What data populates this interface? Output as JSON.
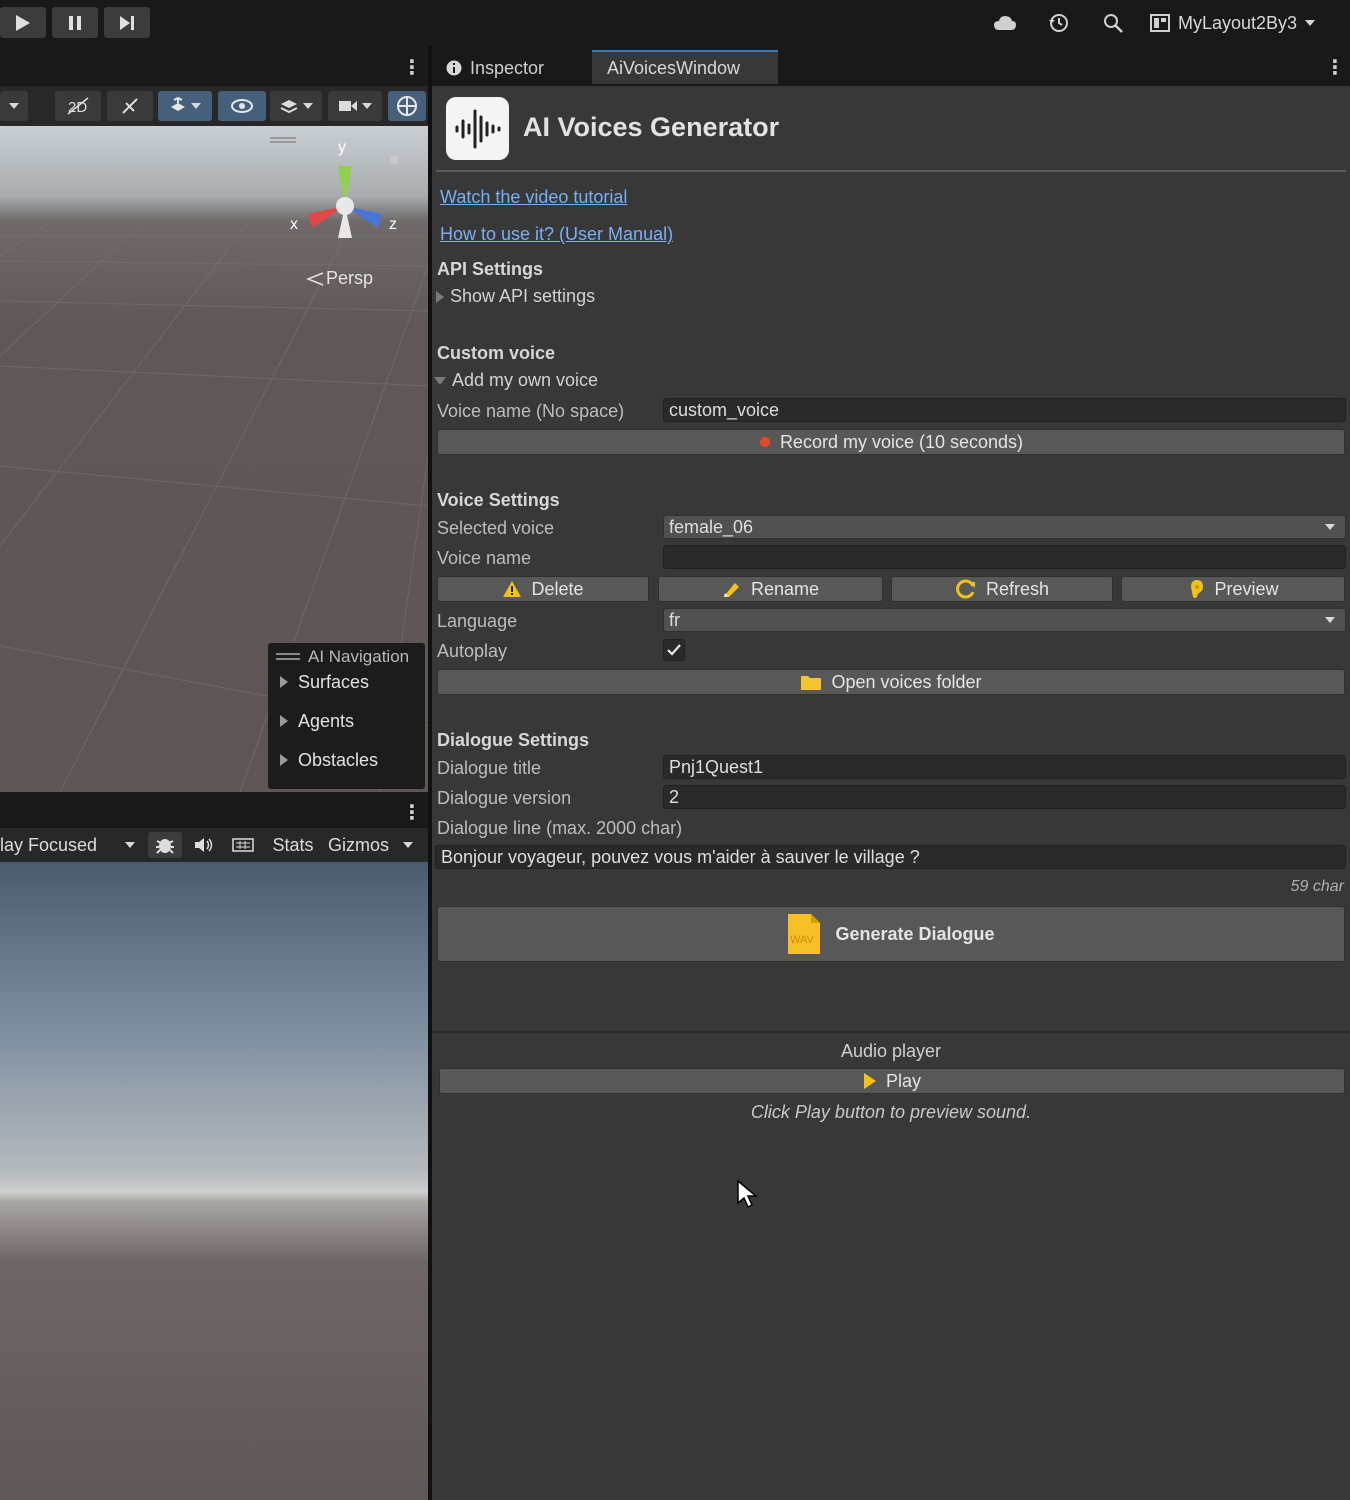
{
  "toolbar": {
    "layout_label": "MyLayout2By3"
  },
  "scene": {
    "persp_label": "Persp",
    "axis_x": "x",
    "axis_y": "y",
    "axis_z": "z",
    "overlay_title": "AI Navigation",
    "overlay_items": [
      {
        "label": "Surfaces"
      },
      {
        "label": "Agents"
      },
      {
        "label": "Obstacles"
      }
    ]
  },
  "game": {
    "play_mode": "lay Focused",
    "stats_label": "Stats",
    "gizmos_label": "Gizmos"
  },
  "tabs": {
    "inspector": "Inspector",
    "ai_voices": "AiVoicesWindow"
  },
  "header": {
    "title": "AI Voices Generator"
  },
  "links": {
    "tutorial": "Watch the video tutorial",
    "manual": "How to use it? (User Manual)"
  },
  "api": {
    "heading": "API Settings",
    "foldout": "Show API settings"
  },
  "custom_voice": {
    "heading": "Custom voice",
    "foldout": "Add my own voice",
    "voice_name_label": "Voice name (No space)",
    "voice_name_value": "custom_voice",
    "record_button": "Record my voice (10 seconds)"
  },
  "voice_settings": {
    "heading": "Voice Settings",
    "selected_voice_label": "Selected voice",
    "selected_voice_value": "female_06",
    "voice_name_label": "Voice name",
    "voice_name_value": "",
    "delete_button": "Delete",
    "rename_button": "Rename",
    "refresh_button": "Refresh",
    "preview_button": "Preview",
    "language_label": "Language",
    "language_value": "fr",
    "autoplay_label": "Autoplay",
    "autoplay_checked": true,
    "open_folder_button": "Open voices folder"
  },
  "dialogue": {
    "heading": "Dialogue Settings",
    "title_label": "Dialogue title",
    "title_value": "Pnj1Quest1",
    "version_label": "Dialogue version",
    "version_value": "2",
    "line_label": "Dialogue line (max. 2000 char)",
    "line_value": "Bonjour voyageur, pouvez vous m'aider à sauver le village ?",
    "char_count": "59 char",
    "generate_button": "Generate Dialogue",
    "wav_badge": "WAV"
  },
  "audio": {
    "heading": "Audio player",
    "play_button": "Play",
    "hint": "Click Play button to preview sound."
  },
  "colors": {
    "accent_tab": "#3a79bb",
    "link": "#7aaef5",
    "warning": "#f2c21a",
    "record_dot": "#e8492a",
    "folder": "#f4c430"
  }
}
